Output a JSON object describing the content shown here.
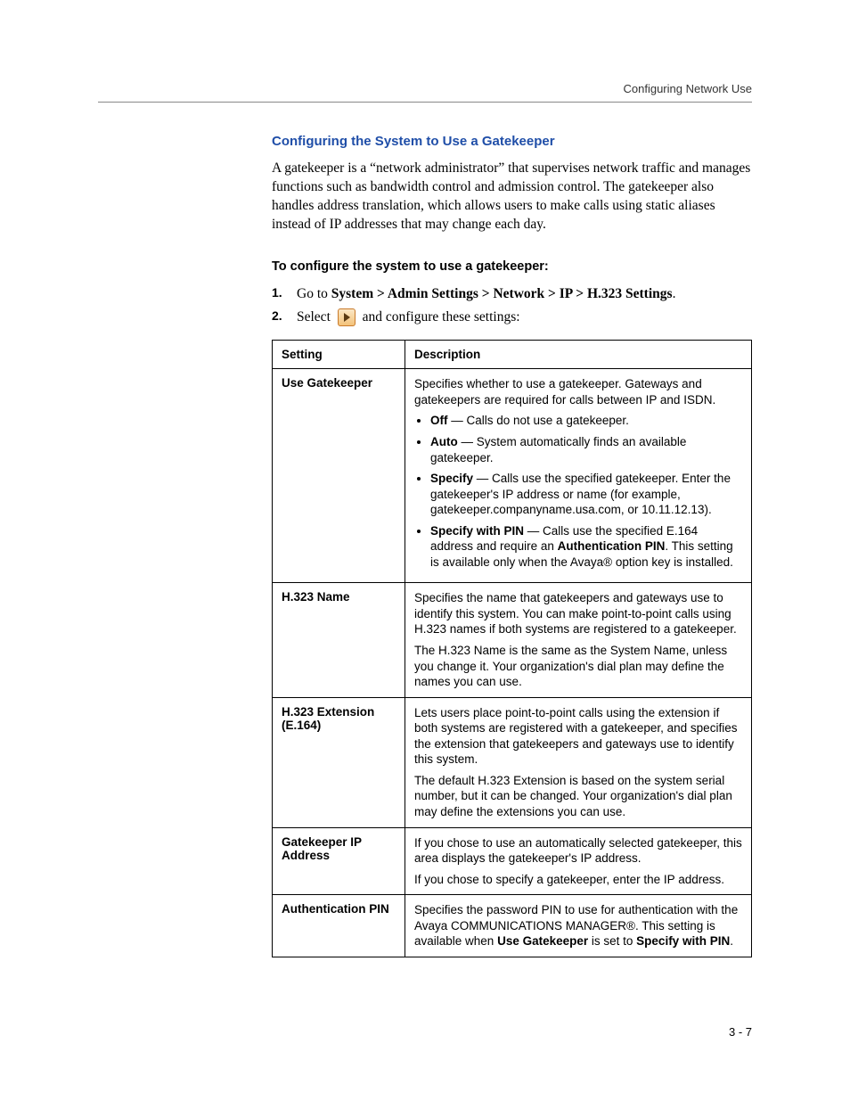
{
  "running_header": "Configuring Network Use",
  "section_title": "Configuring the System to Use a Gatekeeper",
  "intro_paragraph": "A gatekeeper is a “network administrator” that supervises network traffic and manages functions such as bandwidth control and admission control. The gatekeeper also handles address translation, which allows users to make calls using static aliases instead of IP addresses that may change each day.",
  "sub_heading": "To configure the system to use a gatekeeper:",
  "steps": {
    "one_num": "1.",
    "one_prefix": "Go to ",
    "one_path": "System > Admin Settings > Network > IP > H.323 Settings",
    "one_suffix": ".",
    "two_num": "2.",
    "two_prefix": "Select ",
    "two_suffix": " and configure these settings:"
  },
  "icon_name": "next-arrow-icon",
  "table": {
    "header_setting": "Setting",
    "header_description": "Description",
    "rows": {
      "use_gatekeeper": {
        "name": "Use Gatekeeper",
        "intro": "Specifies whether to use a gatekeeper. Gateways and gatekeepers are required for calls between IP and ISDN.",
        "off_label": "Off",
        "off_text": " — Calls do not use a gatekeeper.",
        "auto_label": "Auto",
        "auto_text": " — System automatically finds an available gatekeeper.",
        "specify_label": "Specify",
        "specify_text": " — Calls use the specified gatekeeper. Enter the gatekeeper's IP address or name (for example, gatekeeper.companyname.usa.com, or 10.11.12.13).",
        "specify_pin_label": "Specify with PIN",
        "specify_pin_text_a": " — Calls use the specified E.164 address and require an ",
        "specify_pin_bold": "Authentication PIN",
        "specify_pin_text_b": ". This setting is available only when the Avaya® option key is installed."
      },
      "h323_name": {
        "name": "H.323 Name",
        "p1": "Specifies the name that gatekeepers and gateways use to identify this system. You can make point-to-point calls using H.323 names if both systems are registered to a gatekeeper.",
        "p2": "The H.323 Name is the same as the System Name, unless you change it. Your organization's dial plan may define the names you can use."
      },
      "h323_ext": {
        "name": "H.323 Extension (E.164)",
        "p1": "Lets users place point-to-point calls using the extension if both systems are registered with a gatekeeper, and specifies the extension that gatekeepers and gateways use to identify this system.",
        "p2": "The default H.323 Extension is based on the system serial number, but it can be changed. Your organization's dial plan may define the extensions you can use."
      },
      "gk_ip": {
        "name": "Gatekeeper IP Address",
        "p1": "If you chose to use an automatically selected gatekeeper, this area displays the gatekeeper's IP address.",
        "p2": "If you chose to specify a gatekeeper, enter the IP address."
      },
      "auth_pin": {
        "name": "Authentication PIN",
        "text_a": "Specifies the password PIN to use for authentication with the Avaya COMMUNICATIONS MANAGER®. This setting is available when ",
        "bold_a": "Use Gatekeeper",
        "text_b": " is set to ",
        "bold_b": "Specify with PIN",
        "text_c": "."
      }
    }
  },
  "page_number": "3 - 7"
}
